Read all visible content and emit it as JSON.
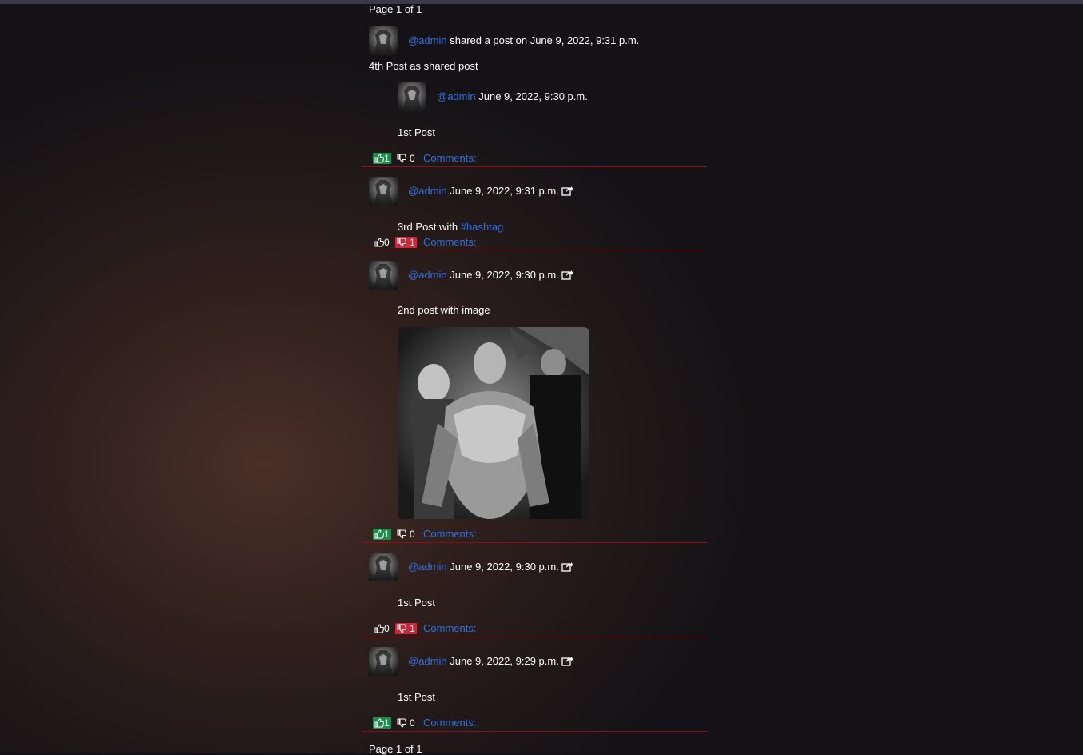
{
  "pagination": {
    "top": "Page 1 of 1",
    "bottom": "Page 1 of 1"
  },
  "shared_post": {
    "author": "@admin",
    "action": "shared a post on June 9, 2022, 9:31 p.m.",
    "text": "4th Post as shared post",
    "original": {
      "author": "@admin",
      "date": "June 9, 2022, 9:30 p.m.",
      "text": "1st Post"
    },
    "likes": "1",
    "dislikes": "0",
    "comments_label": "Comments:"
  },
  "posts": [
    {
      "author": "@admin",
      "date": "June 9, 2022, 9:31 p.m.",
      "text_prefix": "3rd Post with",
      "hashtag": "#hashtag",
      "likes": "0",
      "dislikes": "1",
      "comments_label": "Comments:"
    },
    {
      "author": "@admin",
      "date": "June 9, 2022, 9:30 p.m.",
      "text": "2nd post with image",
      "likes": "1",
      "dislikes": "0",
      "comments_label": "Comments:"
    },
    {
      "author": "@admin",
      "date": "June 9, 2022, 9:30 p.m.",
      "text": "1st Post",
      "likes": "0",
      "dislikes": "1",
      "comments_label": "Comments:"
    },
    {
      "author": "@admin",
      "date": "June 9, 2022, 9:29 p.m.",
      "text": "1st Post",
      "likes": "1",
      "dislikes": "0",
      "comments_label": "Comments:"
    }
  ],
  "icons": {
    "like": "thumbs-up-icon",
    "dislike": "thumbs-down-icon",
    "share": "share-icon",
    "avatar": "avatar"
  },
  "colors": {
    "link": "#2f6fe0",
    "divider": "#8c1018",
    "like_active": "#1f8a4a",
    "dislike_active": "#c9283a"
  }
}
